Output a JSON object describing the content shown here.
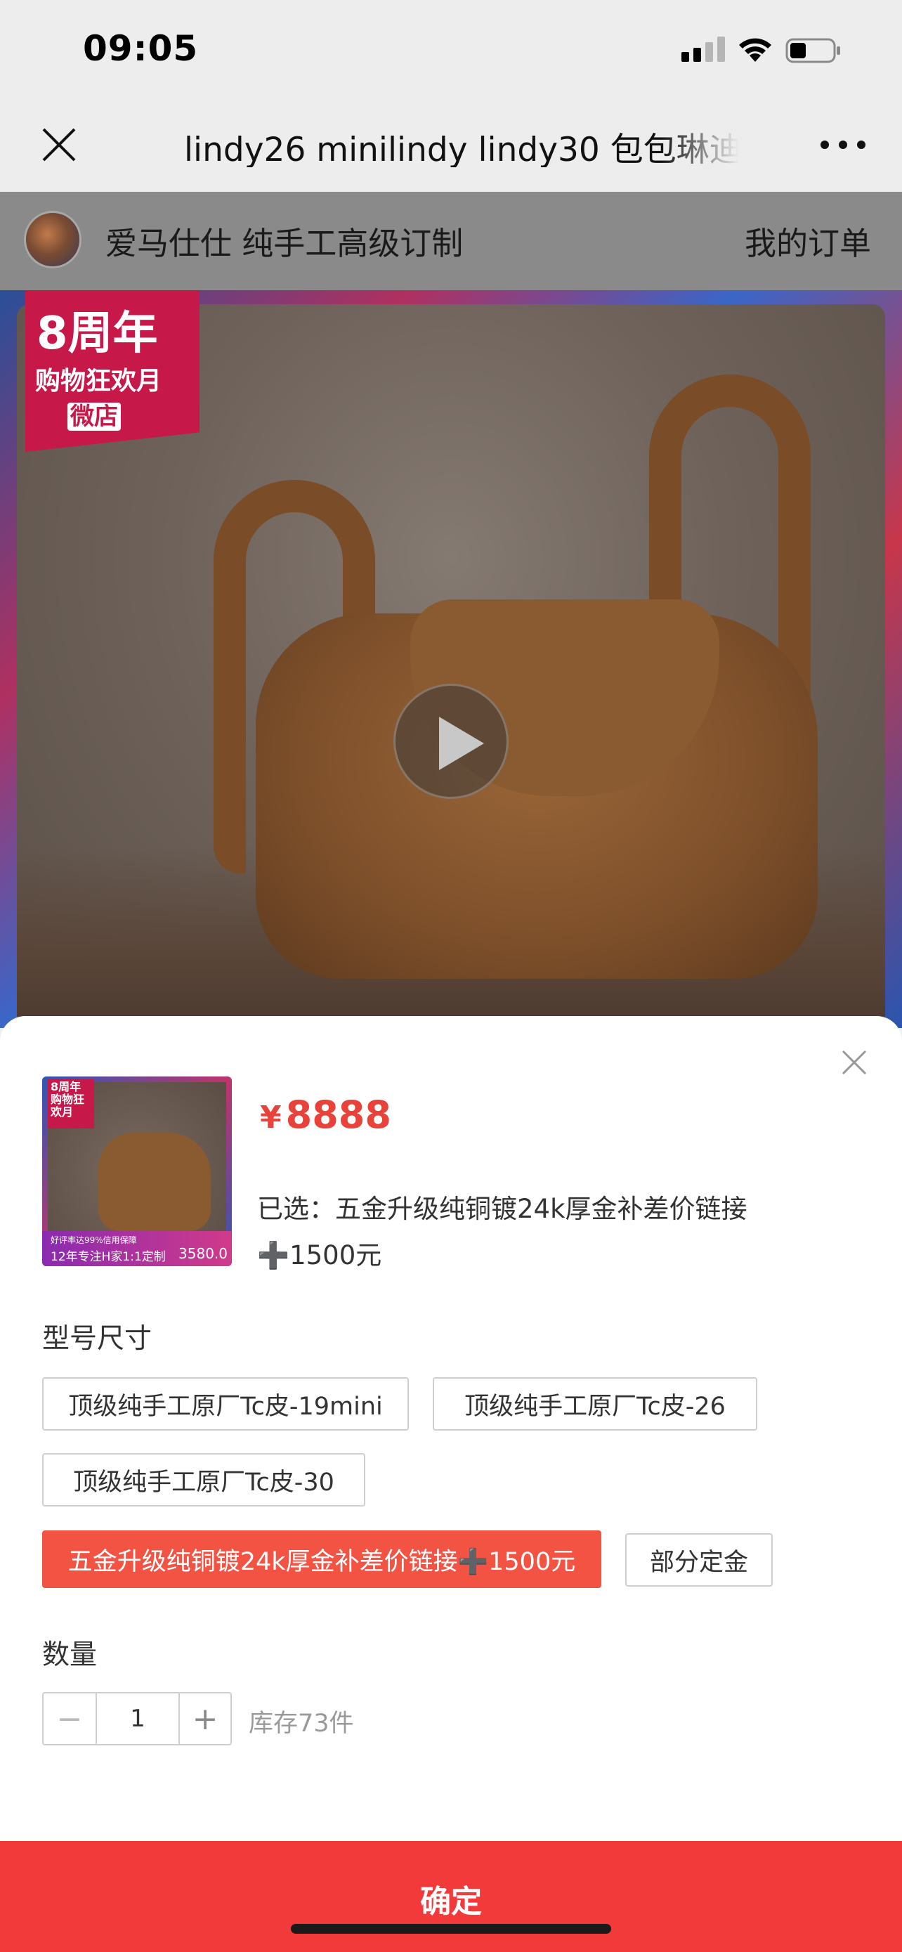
{
  "status_bar": {
    "time": "09:05"
  },
  "nav": {
    "title": "lindy26 minilindy lindy30 包包琳迪"
  },
  "shop": {
    "name": "爱马仕仕 纯手工高级订制",
    "orders_link": "我的订单"
  },
  "hero": {
    "badge_line1": "8周年",
    "badge_line2": "购物狂欢月",
    "badge_line3": "微店"
  },
  "sheet": {
    "price_symbol": "¥",
    "price": "8888",
    "selected_prefix": "已选：",
    "selected_value": "五金升级纯铜镀24k厚金补差价链接",
    "selected_extra": "➕1500元",
    "thumb": {
      "badge": "8周年 购物狂欢月",
      "strip_small": "好评率达99%信用保障",
      "strip_main": "12年专注H家1:1定制",
      "strip_price": "3580.0"
    },
    "size_label": "型号尺寸",
    "options": [
      {
        "label": "顶级纯手工原厂Tc皮-19mini",
        "selected": false
      },
      {
        "label": "顶级纯手工原厂Tc皮-26",
        "selected": false
      },
      {
        "label": "顶级纯手工原厂Tc皮-30",
        "selected": false
      },
      {
        "label": "五金升级纯铜镀24k厚金补差价链接➕1500元",
        "selected": true
      },
      {
        "label": "部分定金",
        "selected": false
      }
    ],
    "quantity_label": "数量",
    "quantity": "1",
    "minus": "−",
    "plus": "+",
    "stock": "库存73件",
    "confirm": "确定"
  },
  "colors": {
    "accent": "#f25343",
    "confirm": "#f23a3a",
    "price": "#e8423a"
  }
}
